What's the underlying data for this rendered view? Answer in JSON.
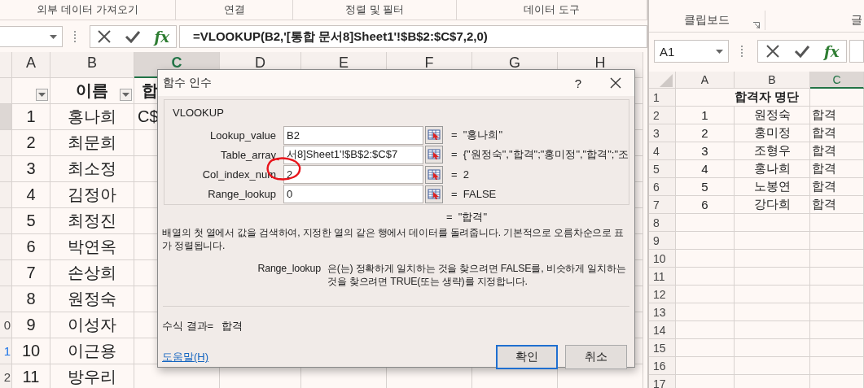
{
  "left_window": {
    "ribbon_groups": [
      "외부 데이터 가져오기",
      "연결",
      "정렬 및 필터",
      "데이터 도구"
    ],
    "formula_bar": {
      "function_button": "fx",
      "formula": "=VLOOKUP(B2,'[통합 문서8]Sheet1'!$B$2:$C$7,2,0)"
    },
    "columns": [
      {
        "label": "A",
        "selected": false
      },
      {
        "label": "B",
        "selected": false
      },
      {
        "label": "C",
        "selected": true
      },
      {
        "label": "D",
        "selected": false
      },
      {
        "label": "E",
        "selected": false
      },
      {
        "label": "F",
        "selected": false
      },
      {
        "label": "G",
        "selected": false
      },
      {
        "label": "H",
        "selected": false
      }
    ],
    "header_row": {
      "name_header": "이름",
      "column_c_header": "합"
    },
    "rows": [
      {
        "selected": true,
        "number": "1",
        "name": "홍나희",
        "column_c": "C$"
      },
      {
        "selected": false,
        "number": "2",
        "name": "최문희"
      },
      {
        "selected": false,
        "number": "3",
        "name": "최소정"
      },
      {
        "selected": false,
        "number": "4",
        "name": "김정아"
      },
      {
        "selected": false,
        "number": "5",
        "name": "최정진"
      },
      {
        "selected": false,
        "number": "6",
        "name": "박연옥"
      },
      {
        "selected": false,
        "number": "7",
        "name": "손상희"
      },
      {
        "selected": false,
        "number": "8",
        "name": "원정숙"
      },
      {
        "selected": false,
        "row_label": "0",
        "number": "9",
        "name": "이성자"
      },
      {
        "selected": false,
        "row_label": "1",
        "number": "10",
        "name": "이근용"
      },
      {
        "selected": false,
        "row_label": "2",
        "number": "11",
        "name": "방우리"
      }
    ]
  },
  "dialog": {
    "title": "함수 인수",
    "help_button": "?",
    "function_name": "VLOOKUP",
    "arguments": [
      {
        "label": "Lookup_value",
        "value": "B2",
        "result": "=  \"홍나희\"",
        "circled": false
      },
      {
        "label": "Table_array",
        "value": "서8]Sheet1'!$B$2:$C$7",
        "result": "=  {\"원정숙\",\"합격\";\"홍미정\",\"합격\";\"조",
        "circled": false
      },
      {
        "label": "Col_index_num",
        "value": "2",
        "result": "=  2",
        "circled": true
      },
      {
        "label": "Range_lookup",
        "value": "0",
        "result": "=  FALSE",
        "circled": false
      }
    ],
    "result_preview": "=  \"합격\"",
    "description": "배열의 첫 열에서 값을 검색하여, 지정한 열의 같은 행에서 데이터를 돌려줍니다. 기본적으로 오름차순으로 표가 정렬됩니다.",
    "argument_help": {
      "name": "Range_lookup",
      "text": "은(는) 정확하게 일치하는 것을 찾으려면 FALSE를, 비슷하게 일치하는 것을 찾으려면 TRUE(또는 생략)를 지정합니다."
    },
    "formula_result": {
      "label": "수식 결과=",
      "value": "합격"
    },
    "help_link": "도움말(H)",
    "buttons": [
      {
        "label": "확인",
        "default": true
      },
      {
        "label": "취소",
        "default": false
      }
    ]
  },
  "right_window": {
    "ribbon_groups": [
      "클립보드",
      "글"
    ],
    "name_box": "A1",
    "function_button": "fx",
    "columns": [
      {
        "label": "A",
        "selected": false
      },
      {
        "label": "B",
        "selected": false
      },
      {
        "label": "C",
        "selected": true
      }
    ],
    "rows": [
      {
        "label": "1",
        "title": "합격자 명단"
      },
      {
        "label": "2",
        "number": "1",
        "name": "원정숙",
        "status": "합격"
      },
      {
        "label": "3",
        "number": "2",
        "name": "홍미정",
        "status": "합격"
      },
      {
        "label": "4",
        "number": "3",
        "name": "조형우",
        "status": "합격"
      },
      {
        "label": "5",
        "number": "4",
        "name": "홍나희",
        "status": "합격"
      },
      {
        "label": "6",
        "number": "5",
        "name": "노봉연",
        "status": "합격"
      },
      {
        "label": "7",
        "number": "6",
        "name": "강다희",
        "status": "합격"
      },
      {
        "label": "8"
      },
      {
        "label": "9"
      },
      {
        "label": "10"
      },
      {
        "label": "11"
      },
      {
        "label": "12"
      },
      {
        "label": "13"
      },
      {
        "label": "14"
      },
      {
        "label": "15"
      },
      {
        "label": "16"
      },
      {
        "label": "17"
      }
    ]
  }
}
